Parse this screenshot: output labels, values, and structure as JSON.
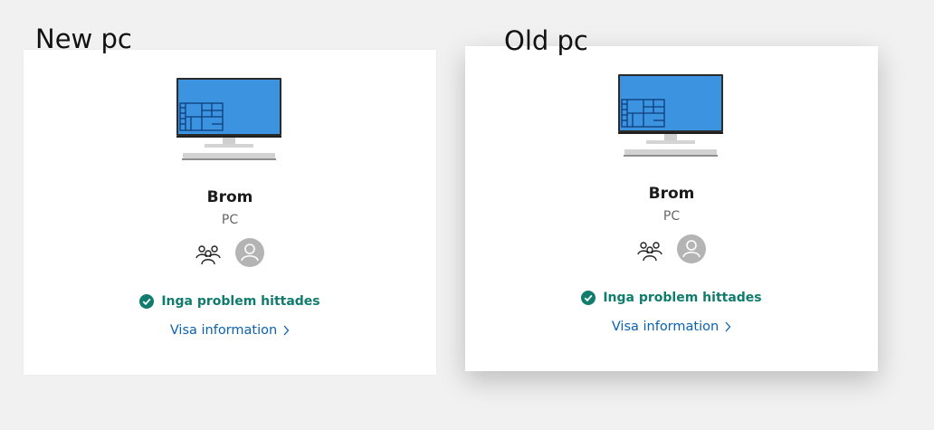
{
  "labels": {
    "new": "New pc",
    "old": "Old pc"
  },
  "cards": [
    {
      "id": "new",
      "device_name": "Brom",
      "device_type": "PC",
      "status_text": "Inga problem hittades",
      "link_text": "Visa information",
      "icons": [
        "monitor-icon",
        "family-icon",
        "avatar-icon",
        "check-circle-icon",
        "chevron-right-icon"
      ]
    },
    {
      "id": "old",
      "device_name": "Brom",
      "device_type": "PC",
      "status_text": "Inga problem hittades",
      "link_text": "Visa information",
      "icons": [
        "monitor-icon",
        "family-icon",
        "avatar-icon",
        "check-circle-icon",
        "chevron-right-icon"
      ]
    }
  ],
  "colors": {
    "background": "#f1f1f1",
    "card": "#ffffff",
    "status_green": "#107c6e",
    "link_blue": "#0a62b1",
    "avatar_gray": "#b4b4b4",
    "screen_blue": "#3c94e0"
  }
}
